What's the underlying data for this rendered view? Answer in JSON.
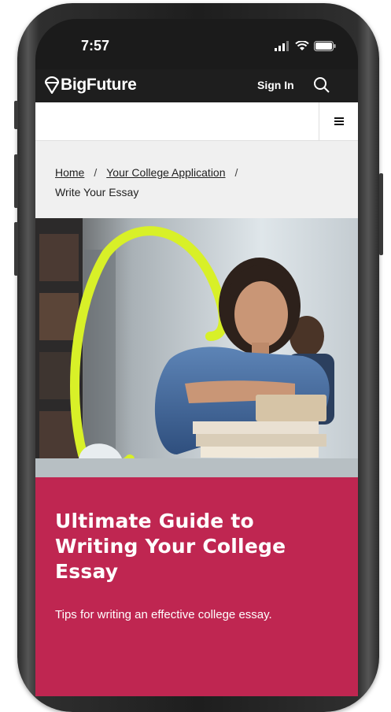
{
  "status_bar": {
    "time": "7:57"
  },
  "header": {
    "brand": "BigFuture",
    "sign_in": "Sign In"
  },
  "breadcrumb": {
    "items": [
      "Home",
      "Your College Application"
    ],
    "separator": "/",
    "current": "Write Your Essay"
  },
  "article": {
    "title": "Ultimate Guide to Writing Your College Essay",
    "subtitle": "Tips for writing an effective college essay."
  },
  "colors": {
    "accent": "#bf2651",
    "nav_bg": "#1e1e1e",
    "highlight": "#d8f028"
  },
  "icons": [
    "signal-icon",
    "wifi-icon",
    "battery-icon",
    "acorn-logo-icon",
    "search-icon",
    "hamburger-menu-icon"
  ]
}
